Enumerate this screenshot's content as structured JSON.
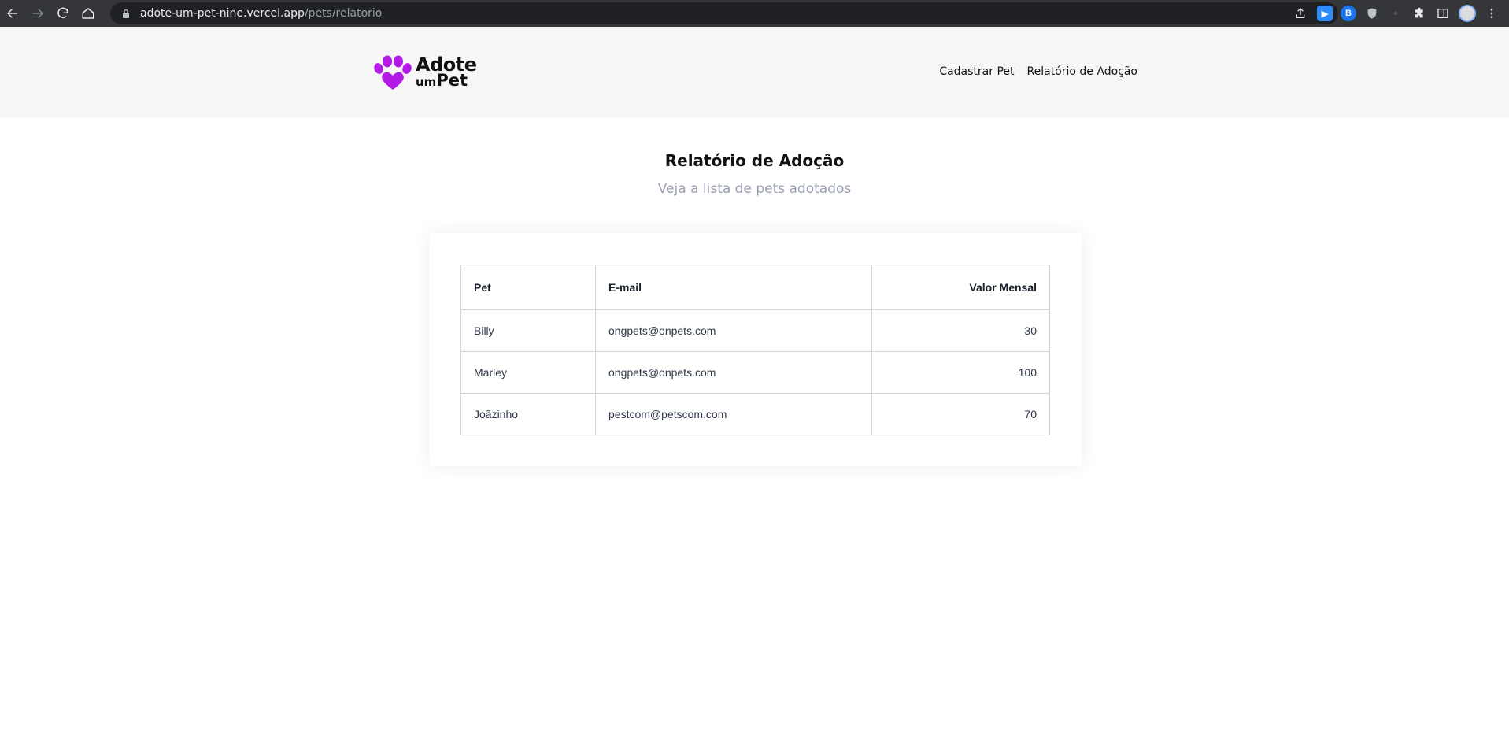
{
  "browser": {
    "url_host": "adote-um-pet-nine.vercel.app",
    "url_path": "/pets/relatorio"
  },
  "header": {
    "logo_line1": "Adote",
    "logo_line2_prefix": "um",
    "logo_line2_bold": "Pet",
    "brand_color": "#b31ae6",
    "nav": [
      {
        "label": "Cadastrar Pet"
      },
      {
        "label": "Relatório de Adoção"
      }
    ]
  },
  "main": {
    "title": "Relatório de Adoção",
    "subtitle": "Veja a lista de pets adotados"
  },
  "table": {
    "headers": [
      "Pet",
      "E-mail",
      "Valor Mensal"
    ],
    "rows": [
      {
        "pet": "Billy",
        "email": "ongpets@onpets.com",
        "valor": "30"
      },
      {
        "pet": "Marley",
        "email": "ongpets@onpets.com",
        "valor": "100"
      },
      {
        "pet": "Joãzinho",
        "email": "pestcom@petscom.com",
        "valor": "70"
      }
    ]
  }
}
